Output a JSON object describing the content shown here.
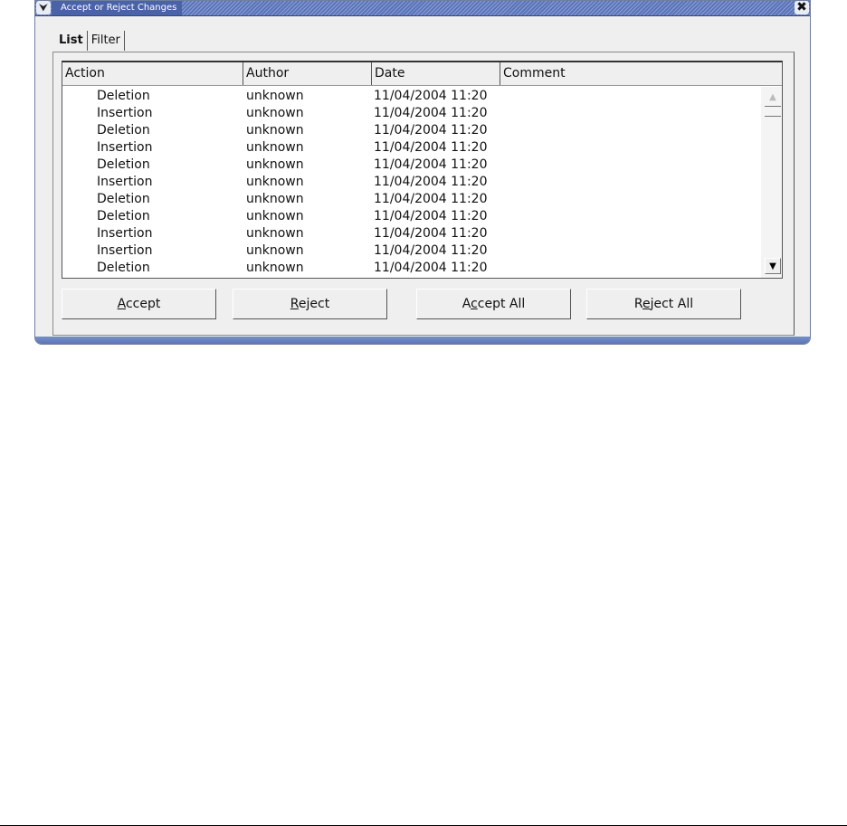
{
  "window": {
    "title": "Accept or Reject Changes",
    "menu_glyph": "⮟",
    "close_glyph": "✖"
  },
  "tabs": [
    {
      "label": "List",
      "active": true
    },
    {
      "label": "Filter",
      "active": false
    }
  ],
  "table": {
    "columns": [
      "Action",
      "Author",
      "Date",
      "Comment"
    ],
    "rows": [
      {
        "action": "Deletion",
        "author": "unknown",
        "date": "11/04/2004 11:20",
        "comment": ""
      },
      {
        "action": "Insertion",
        "author": "unknown",
        "date": "11/04/2004 11:20",
        "comment": ""
      },
      {
        "action": "Deletion",
        "author": "unknown",
        "date": "11/04/2004 11:20",
        "comment": ""
      },
      {
        "action": "Insertion",
        "author": "unknown",
        "date": "11/04/2004 11:20",
        "comment": ""
      },
      {
        "action": "Deletion",
        "author": "unknown",
        "date": "11/04/2004 11:20",
        "comment": ""
      },
      {
        "action": "Insertion",
        "author": "unknown",
        "date": "11/04/2004 11:20",
        "comment": ""
      },
      {
        "action": "Deletion",
        "author": "unknown",
        "date": "11/04/2004 11:20",
        "comment": ""
      },
      {
        "action": "Deletion",
        "author": "unknown",
        "date": "11/04/2004 11:20",
        "comment": ""
      },
      {
        "action": "Insertion",
        "author": "unknown",
        "date": "11/04/2004 11:20",
        "comment": ""
      },
      {
        "action": "Insertion",
        "author": "unknown",
        "date": "11/04/2004 11:20",
        "comment": ""
      },
      {
        "action": "Deletion",
        "author": "unknown",
        "date": "11/04/2004 11:20",
        "comment": ""
      }
    ]
  },
  "scrollbar": {
    "up_icon": "scroll-up-arrow-icon",
    "down_icon": "scroll-down-arrow-icon",
    "up_glyph": "▲",
    "down_glyph": "▼"
  },
  "buttons": {
    "accept": {
      "label": "Accept",
      "mnemonic": "A"
    },
    "reject": {
      "label": "Reject",
      "mnemonic": "R"
    },
    "accept_all": {
      "label": "Accept All",
      "mnemonic": "c"
    },
    "reject_all": {
      "label": "Reject All",
      "mnemonic": "e"
    }
  },
  "colors": {
    "titlebar": "#5b73b8",
    "window_bg": "#efefef",
    "list_bg": "#ffffff"
  }
}
